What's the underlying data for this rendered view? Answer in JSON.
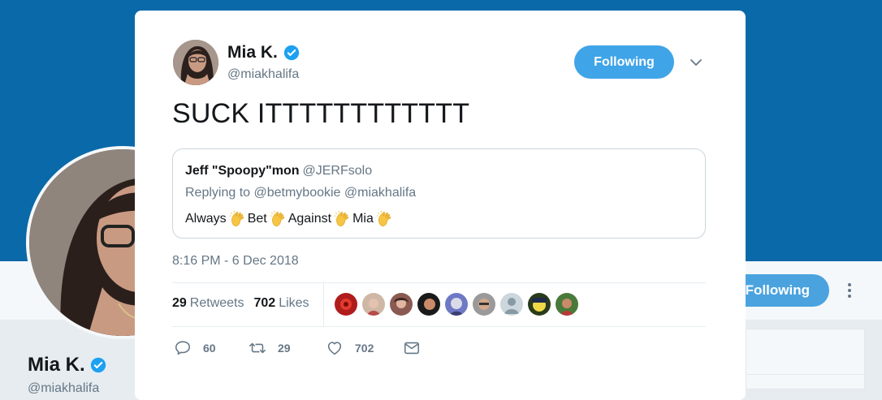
{
  "background": {
    "profile_name": "Mia K.",
    "profile_handle": "@miakhalifa",
    "following_label": "Following"
  },
  "tweet": {
    "author_name": "Mia K.",
    "author_handle": "@miakhalifa",
    "following_label": "Following",
    "text": "SUCK ITTTTTTTTTTTT",
    "timestamp": "8:16 PM - 6 Dec 2018",
    "quote": {
      "name": "Jeff \"Spoopy\"mon",
      "handle": "@JERFsolo",
      "reply_line": "Replying to @betmybookie @miakhalifa",
      "words": [
        "Always",
        "Bet",
        "Against",
        "Mia"
      ]
    },
    "stats": {
      "retweets_count": "29",
      "retweets_label": "Retweets",
      "likes_count": "702",
      "likes_label": "Likes"
    },
    "actions": {
      "replies": "60",
      "retweets": "29",
      "likes": "702"
    }
  },
  "colors": {
    "banner": "#0a69a8",
    "accent": "#3fa4e8",
    "verified": "#1da1f2"
  },
  "icons": [
    "verified-badge-icon",
    "chevron-down-icon",
    "clap-emoji-icon",
    "reply-icon",
    "retweet-icon",
    "heart-icon",
    "message-icon",
    "more-icon"
  ]
}
